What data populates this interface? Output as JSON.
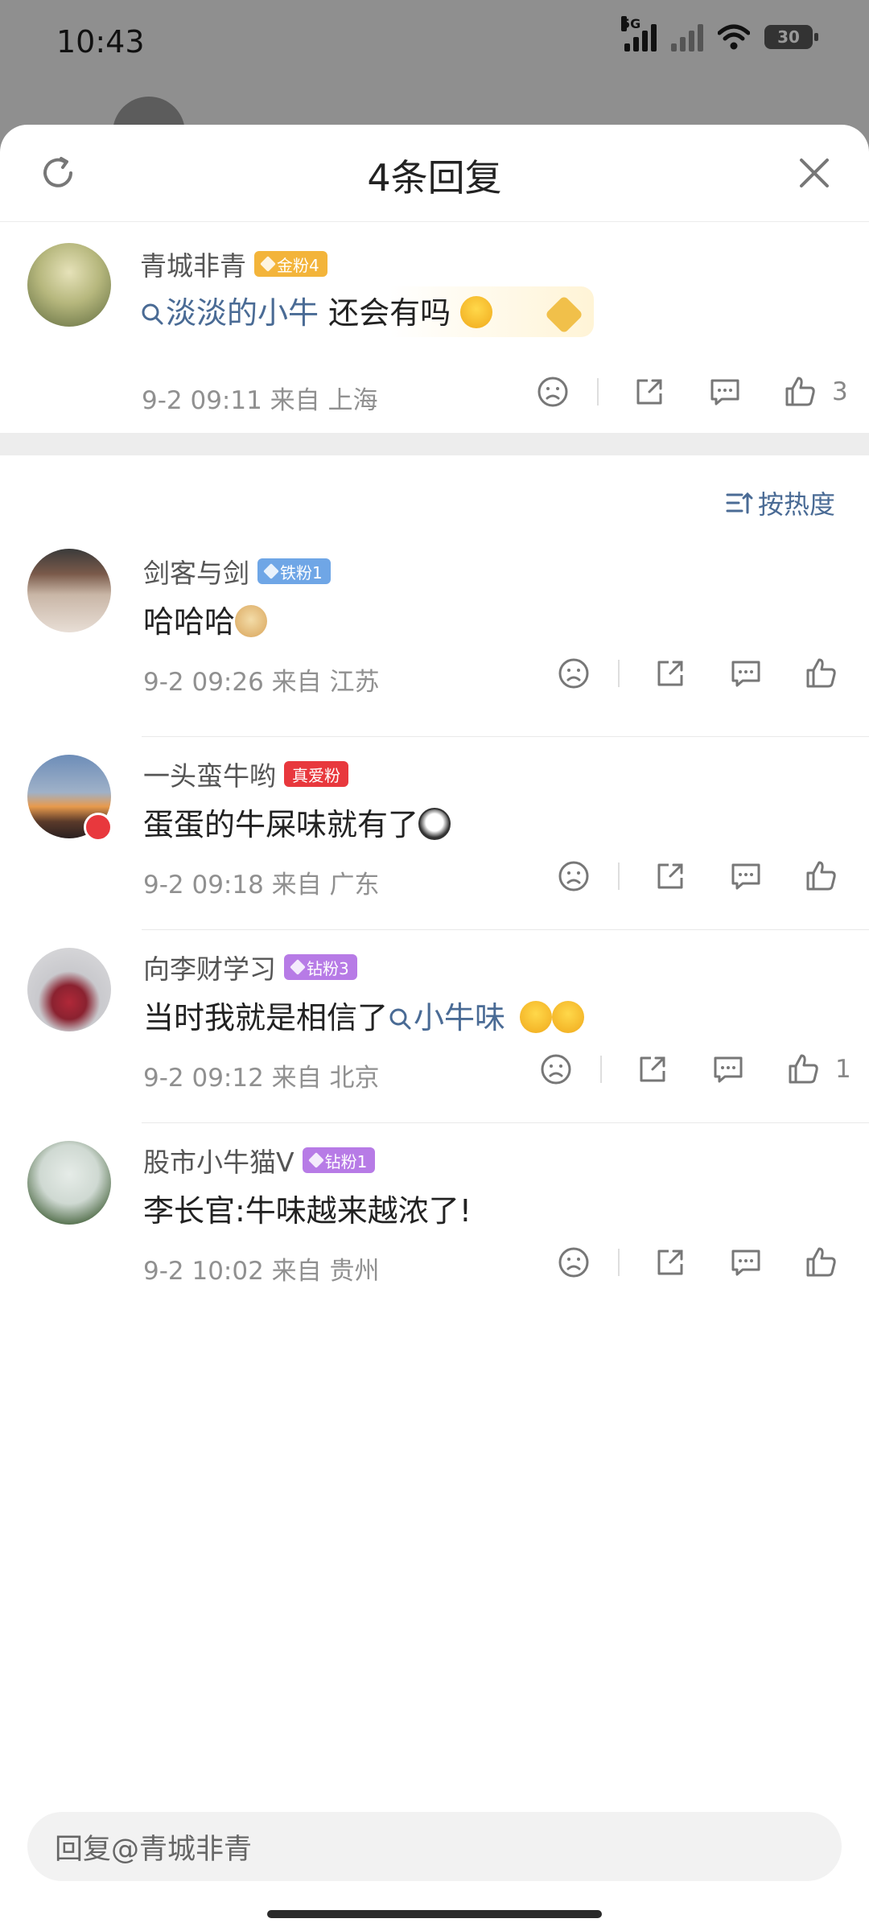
{
  "status_bar": {
    "time": "10:43",
    "network_tag": "5G",
    "battery": "30"
  },
  "sheet": {
    "title": "4条回复",
    "sort_label": "按热度"
  },
  "root_comment": {
    "user": "青城非青",
    "badge": "金粉4",
    "mention": "淡淡的小牛",
    "text": "还会有吗",
    "meta": "9-2 09:11 来自 上海",
    "likes": "3"
  },
  "replies": [
    {
      "user": "剑客与剑",
      "badge": "铁粉1",
      "text": "哈哈哈",
      "meta": "9-2 09:26 来自 江苏",
      "likes": ""
    },
    {
      "user": "一头蛮牛哟",
      "badge": "真爱粉",
      "text": "蛋蛋的牛屎味就有了",
      "meta": "9-2 09:18 来自 广东",
      "likes": ""
    },
    {
      "user": "向李财学习",
      "badge": "钻粉3",
      "text": "当时我就是相信了",
      "topic": "小牛味",
      "meta": "9-2 09:12 来自 北京",
      "likes": "1"
    },
    {
      "user": "股市小牛猫V",
      "badge": "钻粉1",
      "text": "李长官:牛味越来越浓了!",
      "meta": "9-2 10:02 来自 贵州",
      "likes": ""
    }
  ],
  "input": {
    "placeholder": "回复@青城非青"
  },
  "colors": {
    "accent": "#4a6b95",
    "badge_gold": "#f3b43a",
    "badge_iron": "#6fa6e6",
    "badge_love": "#e8383d",
    "badge_diamond": "#b77be6"
  }
}
